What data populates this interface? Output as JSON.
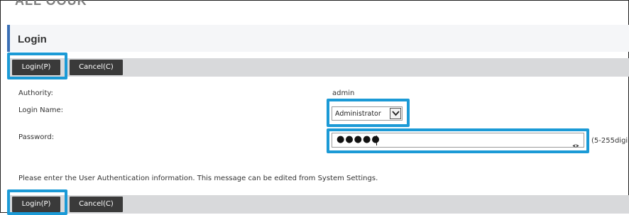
{
  "app": {
    "top_title_partial": "ALL OOUK"
  },
  "header": {
    "title": "Login"
  },
  "toolbar_top": {
    "login_label": "Login(P)",
    "cancel_label": "Cancel(C)"
  },
  "form": {
    "authority_label": "Authority:",
    "authority_value": "admin",
    "login_name_label": "Login Name:",
    "login_name_value": "Administrator",
    "password_label": "Password:",
    "password_mask": "●●●●●",
    "password_hint": "(5-255digi"
  },
  "message": "Please enter the User Authentication information. This message can be edited from System Settings.",
  "toolbar_bottom": {
    "login_label": "Login(P)",
    "cancel_label": "Cancel(C)"
  },
  "colors": {
    "accent": "#3a6fb5",
    "highlight": "#1b9ad6",
    "button_bg": "#3a3a3a",
    "toolbar_bg": "#d8d9db"
  },
  "icons": {
    "select_arrow": "chevron-down-icon",
    "password_reveal": "eye-icon"
  }
}
